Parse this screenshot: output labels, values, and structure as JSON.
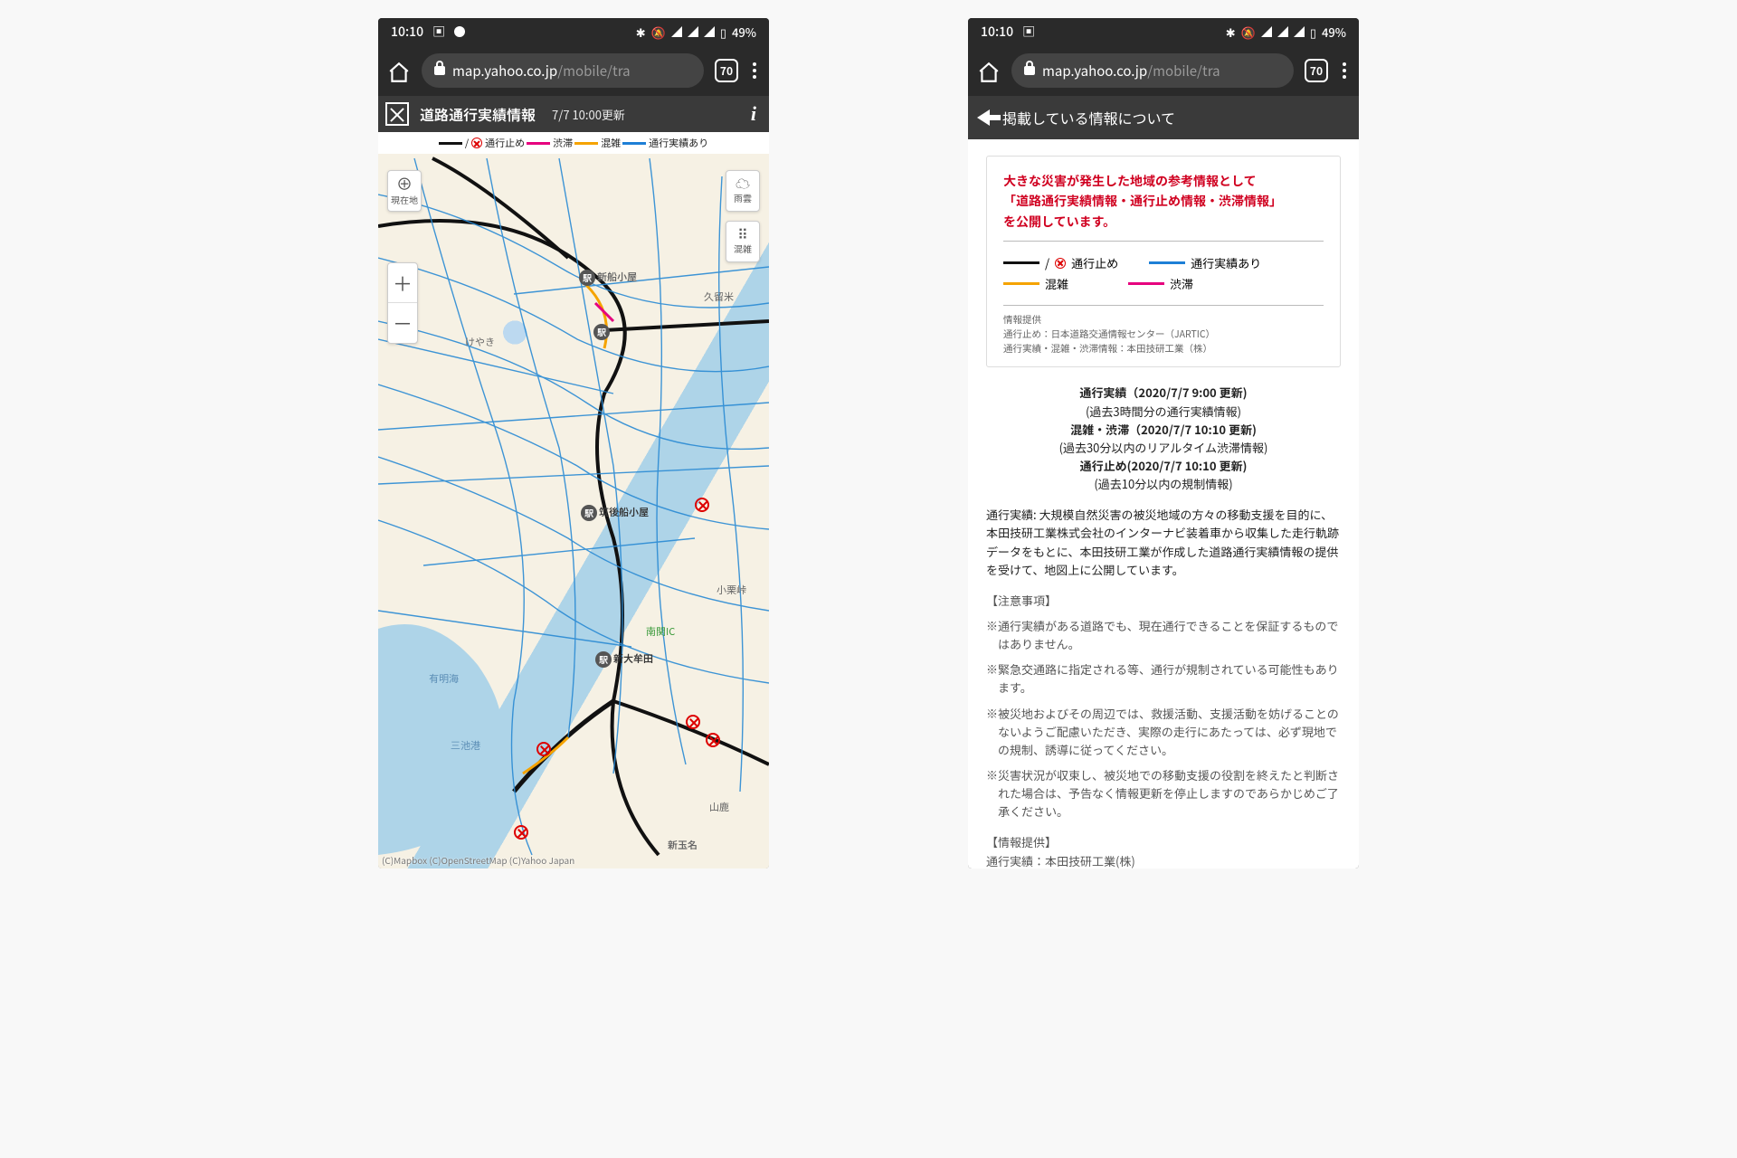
{
  "statusbar": {
    "time": "10:10",
    "battery": "49%"
  },
  "browser": {
    "url_visible_host": "map.yahoo.co.jp",
    "url_visible_path": "/mobile/tra",
    "tab_count": "70"
  },
  "left": {
    "title": "道路通行実績情報",
    "updated": "7/7 10:00更新",
    "legend": {
      "closed": "通行止め",
      "jam": "渋滞",
      "congested": "混雑",
      "passable": "通行実績あり"
    },
    "controls": {
      "current_loc": "現在地",
      "rain": "雨雲",
      "congestion": "混雑"
    },
    "places": {
      "shinsen": "新船小屋",
      "chikugo": "筑後船小屋",
      "shinomuta": "新大牟田",
      "ariake": "有明海",
      "miike": "三池港",
      "nankan_ic": "南関IC",
      "shintamana": "新玉名",
      "kurume": "久留米",
      "keyaki": "けやき",
      "okuri": "小栗峠",
      "yamaga": "山鹿"
    },
    "attribution": "(C)Mapbox (C)OpenStreetMap (C)Yahoo Japan"
  },
  "right": {
    "header": "掲載している情報について",
    "red1": "大きな災害が発生した地域の参考情報として",
    "red2": "「道路通行実績情報・通行止め情報・渋滞情報」",
    "red3": "を公開しています。",
    "legend": {
      "closed": "通行止め",
      "passable": "通行実績あり",
      "congested": "混雑",
      "jam": "渋滞"
    },
    "src_h": "情報提供",
    "src1": "通行止め：日本道路交通情報センター（JARTIC）",
    "src2": "通行実績・混雑・渋滞情報：本田技研工業（株）",
    "updates": {
      "u1_title": "通行実績（2020/7/7 9:00 更新)",
      "u1_sub": "(過去3時間分の通行実績情報)",
      "u2_title": "混雑・渋滞（2020/7/7 10:10 更新)",
      "u2_sub": "(過去30分以内のリアルタイム渋滞情報)",
      "u3_title": "通行止め(2020/7/7 10:10 更新)",
      "u3_sub": "(過去10分以内の規制情報)"
    },
    "para1": "通行実績: 大規模自然災害の被災地域の方々の移動支援を目的に、本田技研工業株式会社のインターナビ装着車から収集した走行軌跡データをもとに、本田技研工業が作成した道路通行実績情報の提供を受けて、地図上に公開しています。",
    "notes_h": "【注意事項】",
    "note1": "※通行実績がある道路でも、現在通行できることを保証するものではありません。",
    "note2": "※緊急交通路に指定される等、通行が規制されている可能性もあります。",
    "note3": "※被災地およびその周辺では、救援活動、支援活動を妨げることのないようご配慮いただき、実際の走行にあたっては、必ず現地での規制、誘導に従ってください。",
    "note4": "※災害状況が収束し、被災地での移動支援の役割を終えたと判断された場合は、予告なく情報更新を停止しますのであらかじめご了承ください。",
    "prov_h": "【情報提供】",
    "prov1": "通行実績：本田技研工業(株)"
  },
  "colors": {
    "closed": "#111111",
    "jam": "#e6007e",
    "congested": "#f5a300",
    "passable": "#1e7fd6"
  }
}
